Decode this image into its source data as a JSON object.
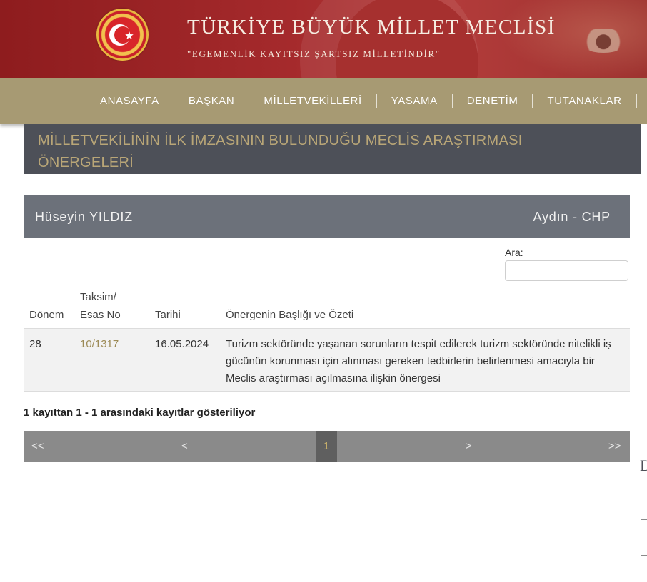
{
  "header": {
    "title": "TÜRKİYE BÜYÜK MİLLET MECLİSİ",
    "motto": "\"EGEMENLİK KAYITSIZ ŞARTSIZ MİLLETİNDİR\""
  },
  "nav": {
    "items": [
      {
        "label": "ANASAYFA"
      },
      {
        "label": "BAŞKAN"
      },
      {
        "label": "MİLLETVEKİLLERİ"
      },
      {
        "label": "YASAMA"
      },
      {
        "label": "DENETİM"
      },
      {
        "label": "TUTANAKLAR"
      }
    ]
  },
  "page": {
    "title": "MİLLETVEKİLİNİN İLK İMZASININ BULUNDUĞU MECLİS ARAŞTIRMASI ÖNERGELERİ"
  },
  "deputy": {
    "name": "Hüseyin YILDIZ",
    "province_party": "Aydın - CHP"
  },
  "search": {
    "label": "Ara:",
    "value": "",
    "placeholder": ""
  },
  "table": {
    "headers": {
      "donem": "Dönem",
      "taksim_line1": "Taksim/",
      "taksim_line2": "Esas No",
      "tarih": "Tarihi",
      "baslik": "Önergenin Başlığı ve Özeti"
    },
    "rows": [
      {
        "donem": "28",
        "esas_no": "10/1317",
        "tarih": "16.05.2024",
        "ozet": "Turizm sektöründe yaşanan sorunların tespit edilerek turizm sektöründe nitelikli iş gücünün korunması için alınması gereken tedbirlerin belirlenmesi amacıyla bir Meclis araştırması açılmasına ilişkin önergesi"
      }
    ]
  },
  "info": "1 kayıttan 1 - 1 arasındaki kayıtlar gösteriliyor",
  "pagination": {
    "first": "<<",
    "prev": "<",
    "current": "1",
    "next": ">",
    "last": ">>"
  },
  "side_widget": {
    "letter": "D"
  },
  "colors": {
    "header_red": "#a52a2c",
    "nav_gold": "#a79a73",
    "title_band": "#4d5058",
    "title_text": "#b9a677",
    "deputy_bar": "#6c717a",
    "link": "#9c8a55",
    "pager": "#8a8a8a",
    "pager_active": "#5f5f5f"
  }
}
